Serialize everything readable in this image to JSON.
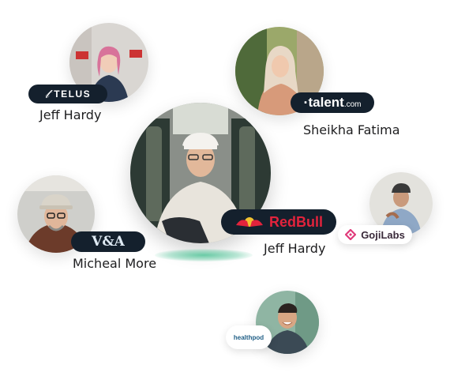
{
  "people": [
    {
      "name": "Jeff Hardy",
      "brand": "TELUS",
      "brand_mark": "𝓉"
    },
    {
      "name": "Sheikha Fatima",
      "brand": "talent",
      "brand_suffix": ".com"
    },
    {
      "name": "Jeff Hardy",
      "brand": "RedBull"
    },
    {
      "name": "Micheal More",
      "brand": "V&A"
    },
    {
      "name": "",
      "brand": "GojiLabs"
    },
    {
      "name": "",
      "brand": "healthpod"
    }
  ],
  "colors": {
    "badge_dark": "#14202d",
    "redbull_red": "#e2233c",
    "goji_pink": "#e03a7a",
    "talent_white": "#ffffff",
    "accent_glow": "#3cbe8c"
  },
  "icons": [
    "telus-logo-icon",
    "talent-logo-icon",
    "redbull-logo-icon",
    "va-logo-icon",
    "gojilabs-logo-icon",
    "healthpod-logo-icon"
  ]
}
